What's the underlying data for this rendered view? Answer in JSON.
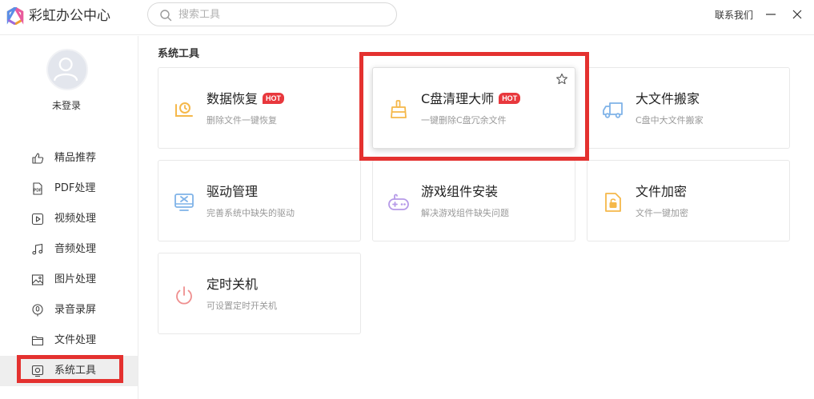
{
  "app": {
    "title": "彩虹办公中心"
  },
  "search": {
    "placeholder": "搜索工具"
  },
  "header": {
    "contact_label": "联系我们"
  },
  "user": {
    "status": "未登录"
  },
  "sidebar": {
    "items": [
      {
        "label": "精品推荐",
        "icon": "thumbs-up-icon"
      },
      {
        "label": "PDF处理",
        "icon": "pdf-icon"
      },
      {
        "label": "视频处理",
        "icon": "video-icon"
      },
      {
        "label": "音频处理",
        "icon": "music-icon"
      },
      {
        "label": "图片处理",
        "icon": "image-icon"
      },
      {
        "label": "录音录屏",
        "icon": "microphone-icon"
      },
      {
        "label": "文件处理",
        "icon": "folder-icon"
      },
      {
        "label": "系统工具",
        "icon": "system-tool-icon",
        "active": true
      }
    ]
  },
  "main": {
    "section_title": "系统工具",
    "hot_badge": "HOT",
    "cards": [
      {
        "title": "数据恢复",
        "desc": "删除文件一键恢复",
        "hot": true,
        "icon": "data-recovery-icon"
      },
      {
        "title": "C盘清理大师",
        "desc": "一键删除C盘冗余文件",
        "hot": true,
        "icon": "broom-icon"
      },
      {
        "title": "大文件搬家",
        "desc": "C盘中大文件搬家",
        "hot": false,
        "icon": "truck-icon"
      },
      {
        "title": "驱动管理",
        "desc": "完善系统中缺失的驱动",
        "hot": false,
        "icon": "driver-icon"
      },
      {
        "title": "游戏组件安装",
        "desc": "解决游戏组件缺失问题",
        "hot": false,
        "icon": "gamepad-icon"
      },
      {
        "title": "文件加密",
        "desc": "文件一键加密",
        "hot": false,
        "icon": "file-lock-icon"
      },
      {
        "title": "定时关机",
        "desc": "可设置定时开关机",
        "hot": false,
        "icon": "power-icon"
      }
    ]
  },
  "colors": {
    "highlight": "#e4312f",
    "hot": "#e8383d",
    "accent_orange": "#f5b84a"
  }
}
